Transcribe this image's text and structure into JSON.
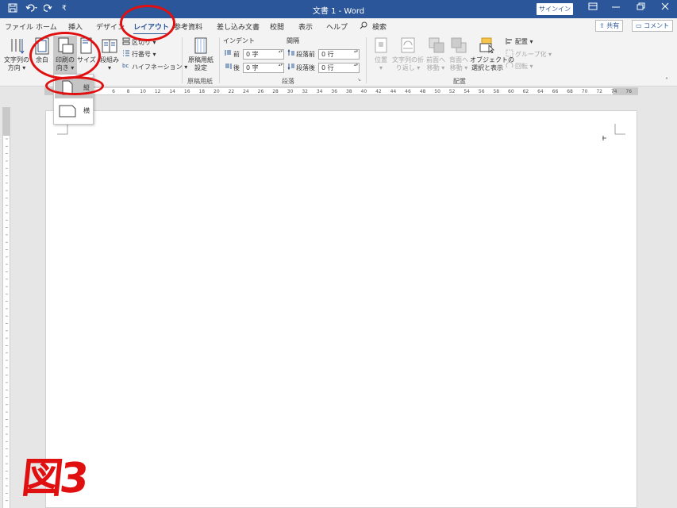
{
  "window": {
    "title": "文書 1 - Word",
    "signin_label": "サインイン",
    "quick_access_more": "₹"
  },
  "tabs": [
    {
      "label": "ファイル"
    },
    {
      "label": "ホーム"
    },
    {
      "label": "挿入"
    },
    {
      "label": "デザイン"
    },
    {
      "label": "レイアウト",
      "active": true
    },
    {
      "label": "参考資料"
    },
    {
      "label": "差し込み文書"
    },
    {
      "label": "校閲"
    },
    {
      "label": "表示"
    },
    {
      "label": "ヘルプ"
    },
    {
      "label": "検索"
    }
  ],
  "share": {
    "share_label": "共有",
    "comment_label": "コメント"
  },
  "ribbon": {
    "page_setup": {
      "text_direction": [
        "文字列の",
        "方向 ▾"
      ],
      "margins": "余白",
      "orientation": [
        "印刷の",
        "向き ▾"
      ],
      "size": "サイズ",
      "columns": [
        "段組み",
        "▾"
      ],
      "breaks": "区切り ▾",
      "line_numbers": "行番号 ▾",
      "hyphenation": "ハイフネーション ▾",
      "group_label": ""
    },
    "manuscript": {
      "button": [
        "原稿用紙",
        "設定"
      ],
      "group_label": "原稿用紙"
    },
    "paragraph": {
      "indent_label": "インデント",
      "spacing_label": "間隔",
      "indent_before_label": "前",
      "indent_before_value": "0 字",
      "indent_after_label": "後",
      "indent_after_value": "0 字",
      "space_before_label": "段落前",
      "space_before_value": "0 行",
      "space_after_label": "段落後",
      "space_after_value": "0 行",
      "group_label": "段落"
    },
    "arrange": {
      "position": [
        "位置",
        "▾"
      ],
      "wrap_text": [
        "文字列の折",
        "り返し ▾"
      ],
      "bring_forward": [
        "前面へ",
        "移動 ▾"
      ],
      "send_backward": [
        "背面へ",
        "移動 ▾"
      ],
      "selection_pane": [
        "オブジェクトの",
        "選択と表示"
      ],
      "align": "配置 ▾",
      "group": "グループ化 ▾",
      "rotate": "回転 ▾",
      "group_label": "配置"
    }
  },
  "ruler": {
    "top_ticks": [
      "6",
      "8",
      "10",
      "12",
      "14",
      "16",
      "18",
      "20",
      "22",
      "24",
      "26",
      "28",
      "30",
      "32",
      "34",
      "36",
      "38",
      "40",
      "42",
      "44",
      "46",
      "48",
      "50",
      "52",
      "54",
      "56",
      "58",
      "60",
      "62",
      "64",
      "66",
      "68",
      "70",
      "72",
      "74",
      "76"
    ]
  },
  "orientation_menu": {
    "portrait_label": "縦",
    "landscape_label": "横"
  },
  "annotation": {
    "figure_label": "図3",
    "color": "#e01010"
  },
  "colors": {
    "titlebar": "#2b579a",
    "ribbon_bg": "#f3f3f3"
  }
}
